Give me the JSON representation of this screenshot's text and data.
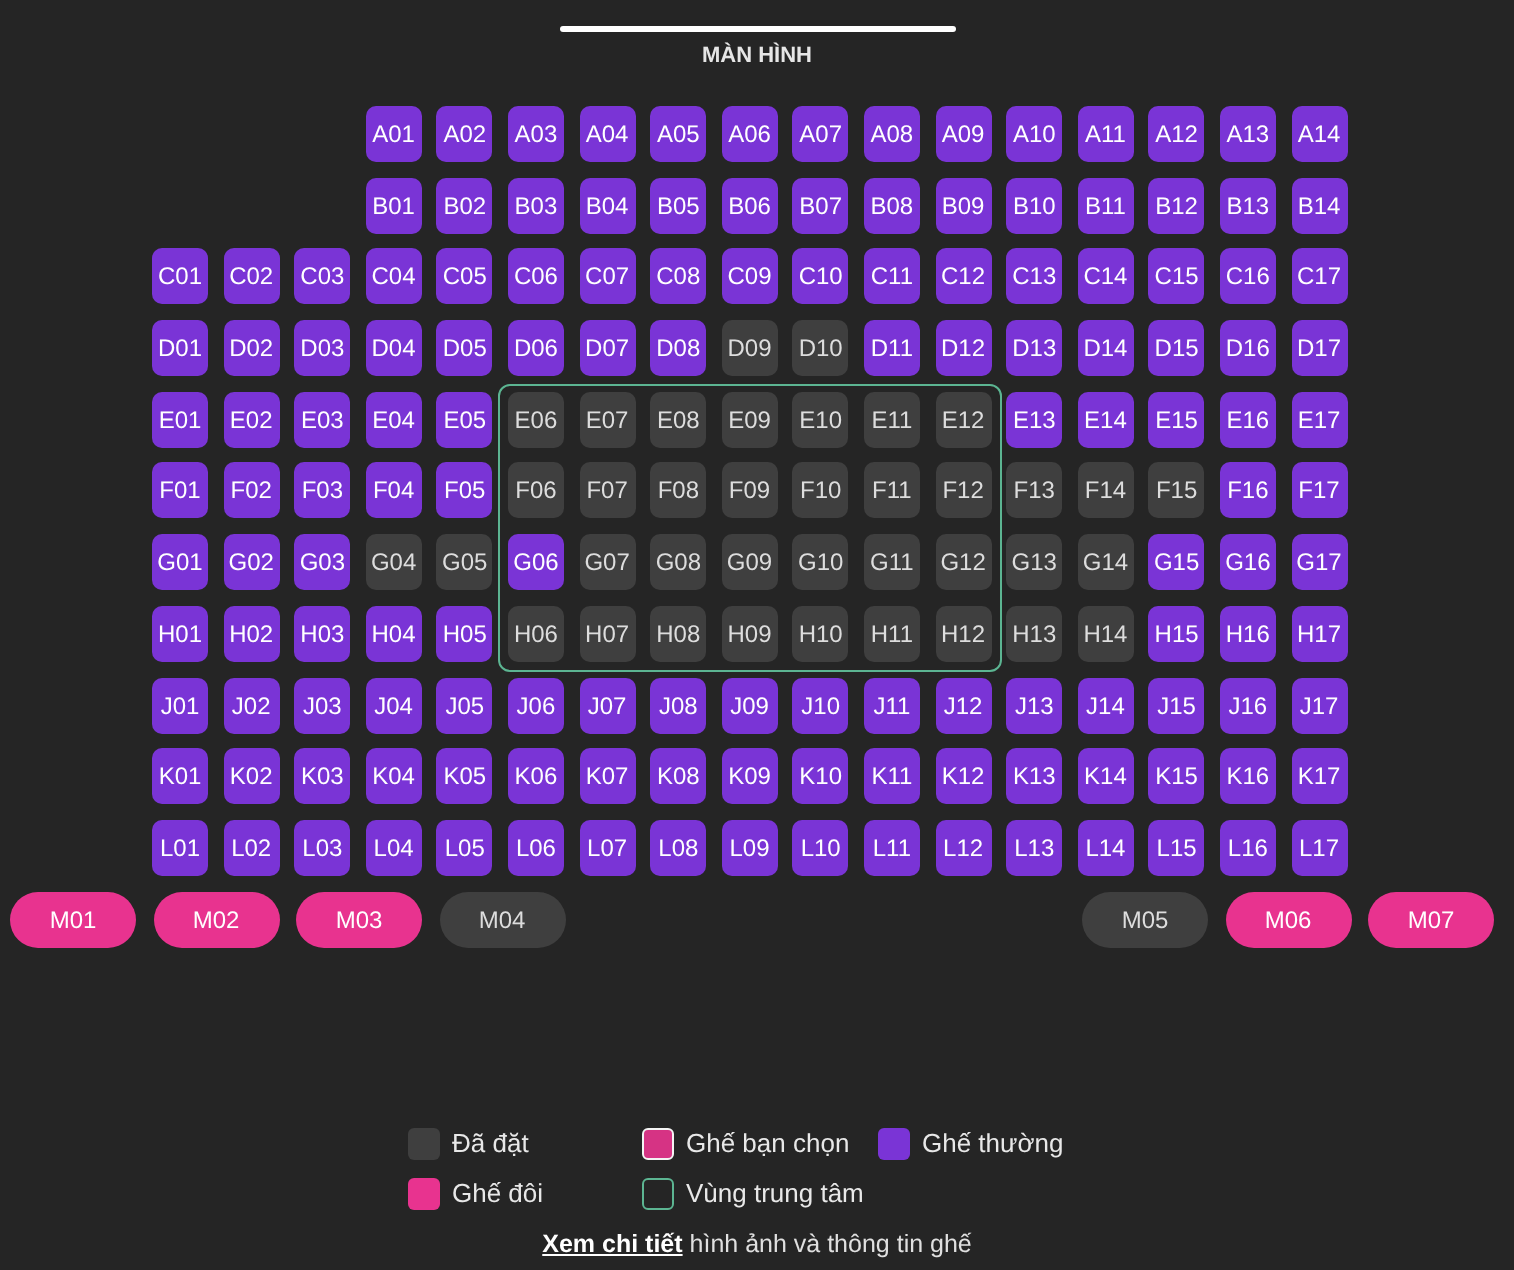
{
  "screen": {
    "label": "MÀN HÌNH"
  },
  "seat_rows": [
    {
      "seats": [
        {
          "label": "A01",
          "booked": false,
          "selected": false
        },
        {
          "label": "A02",
          "booked": false,
          "selected": false
        },
        {
          "label": "A03",
          "booked": false,
          "selected": false
        },
        {
          "label": "A04",
          "booked": false,
          "selected": false
        },
        {
          "label": "A05",
          "booked": false,
          "selected": false
        },
        {
          "label": "A06",
          "booked": false,
          "selected": false
        },
        {
          "label": "A07",
          "booked": false,
          "selected": false
        },
        {
          "label": "A08",
          "booked": false,
          "selected": false
        },
        {
          "label": "A09",
          "booked": false,
          "selected": false
        },
        {
          "label": "A10",
          "booked": false,
          "selected": false
        },
        {
          "label": "A11",
          "booked": false,
          "selected": false
        },
        {
          "label": "A12",
          "booked": false,
          "selected": false
        },
        {
          "label": "A13",
          "booked": false,
          "selected": false
        },
        {
          "label": "A14",
          "booked": false,
          "selected": false
        }
      ]
    },
    {
      "seats": [
        {
          "label": "B01",
          "booked": false,
          "selected": false
        },
        {
          "label": "B02",
          "booked": false,
          "selected": false
        },
        {
          "label": "B03",
          "booked": false,
          "selected": false
        },
        {
          "label": "B04",
          "booked": false,
          "selected": false
        },
        {
          "label": "B05",
          "booked": false,
          "selected": false
        },
        {
          "label": "B06",
          "booked": false,
          "selected": false
        },
        {
          "label": "B07",
          "booked": false,
          "selected": false
        },
        {
          "label": "B08",
          "booked": false,
          "selected": false
        },
        {
          "label": "B09",
          "booked": false,
          "selected": false
        },
        {
          "label": "B10",
          "booked": false,
          "selected": false
        },
        {
          "label": "B11",
          "booked": false,
          "selected": false
        },
        {
          "label": "B12",
          "booked": false,
          "selected": false
        },
        {
          "label": "B13",
          "booked": false,
          "selected": false
        },
        {
          "label": "B14",
          "booked": false,
          "selected": false
        }
      ]
    },
    {
      "seats": [
        {
          "label": "C01",
          "booked": false,
          "selected": false
        },
        {
          "label": "C02",
          "booked": false,
          "selected": false
        },
        {
          "label": "C03",
          "booked": false,
          "selected": false
        },
        {
          "label": "C04",
          "booked": false,
          "selected": false
        },
        {
          "label": "C05",
          "booked": false,
          "selected": false
        },
        {
          "label": "C06",
          "booked": false,
          "selected": false
        },
        {
          "label": "C07",
          "booked": false,
          "selected": false
        },
        {
          "label": "C08",
          "booked": false,
          "selected": false
        },
        {
          "label": "C09",
          "booked": false,
          "selected": false
        },
        {
          "label": "C10",
          "booked": false,
          "selected": false
        },
        {
          "label": "C11",
          "booked": false,
          "selected": false
        },
        {
          "label": "C12",
          "booked": false,
          "selected": false
        },
        {
          "label": "C13",
          "booked": false,
          "selected": false
        },
        {
          "label": "C14",
          "booked": false,
          "selected": false
        },
        {
          "label": "C15",
          "booked": false,
          "selected": false
        },
        {
          "label": "C16",
          "booked": false,
          "selected": false
        },
        {
          "label": "C17",
          "booked": false,
          "selected": false
        }
      ]
    },
    {
      "seats": [
        {
          "label": "D01",
          "booked": false,
          "selected": false
        },
        {
          "label": "D02",
          "booked": false,
          "selected": false
        },
        {
          "label": "D03",
          "booked": false,
          "selected": false
        },
        {
          "label": "D04",
          "booked": false,
          "selected": false
        },
        {
          "label": "D05",
          "booked": false,
          "selected": false
        },
        {
          "label": "D06",
          "booked": false,
          "selected": false
        },
        {
          "label": "D07",
          "booked": false,
          "selected": false
        },
        {
          "label": "D08",
          "booked": false,
          "selected": false
        },
        {
          "label": "D09",
          "booked": true,
          "selected": false
        },
        {
          "label": "D10",
          "booked": true,
          "selected": false
        },
        {
          "label": "D11",
          "booked": false,
          "selected": false
        },
        {
          "label": "D12",
          "booked": false,
          "selected": false
        },
        {
          "label": "D13",
          "booked": false,
          "selected": false
        },
        {
          "label": "D14",
          "booked": false,
          "selected": false
        },
        {
          "label": "D15",
          "booked": false,
          "selected": false
        },
        {
          "label": "D16",
          "booked": false,
          "selected": false
        },
        {
          "label": "D17",
          "booked": false,
          "selected": false
        }
      ]
    },
    {
      "seats": [
        {
          "label": "E01",
          "booked": false,
          "selected": false
        },
        {
          "label": "E02",
          "booked": false,
          "selected": false
        },
        {
          "label": "E03",
          "booked": false,
          "selected": false
        },
        {
          "label": "E04",
          "booked": false,
          "selected": false
        },
        {
          "label": "E05",
          "booked": false,
          "selected": false
        },
        {
          "label": "E06",
          "booked": true,
          "selected": false
        },
        {
          "label": "E07",
          "booked": true,
          "selected": false
        },
        {
          "label": "E08",
          "booked": true,
          "selected": false
        },
        {
          "label": "E09",
          "booked": true,
          "selected": false
        },
        {
          "label": "E10",
          "booked": true,
          "selected": false
        },
        {
          "label": "E11",
          "booked": true,
          "selected": false
        },
        {
          "label": "E12",
          "booked": true,
          "selected": false
        },
        {
          "label": "E13",
          "booked": false,
          "selected": false
        },
        {
          "label": "E14",
          "booked": false,
          "selected": false
        },
        {
          "label": "E15",
          "booked": false,
          "selected": false
        },
        {
          "label": "E16",
          "booked": false,
          "selected": false
        },
        {
          "label": "E17",
          "booked": false,
          "selected": false
        }
      ]
    },
    {
      "seats": [
        {
          "label": "F01",
          "booked": false,
          "selected": false
        },
        {
          "label": "F02",
          "booked": false,
          "selected": false
        },
        {
          "label": "F03",
          "booked": false,
          "selected": false
        },
        {
          "label": "F04",
          "booked": false,
          "selected": false
        },
        {
          "label": "F05",
          "booked": false,
          "selected": false
        },
        {
          "label": "F06",
          "booked": true,
          "selected": false
        },
        {
          "label": "F07",
          "booked": true,
          "selected": false
        },
        {
          "label": "F08",
          "booked": true,
          "selected": false
        },
        {
          "label": "F09",
          "booked": true,
          "selected": false
        },
        {
          "label": "F10",
          "booked": true,
          "selected": false
        },
        {
          "label": "F11",
          "booked": true,
          "selected": false
        },
        {
          "label": "F12",
          "booked": true,
          "selected": false
        },
        {
          "label": "F13",
          "booked": true,
          "selected": false
        },
        {
          "label": "F14",
          "booked": true,
          "selected": false
        },
        {
          "label": "F15",
          "booked": true,
          "selected": false
        },
        {
          "label": "F16",
          "booked": false,
          "selected": false
        },
        {
          "label": "F17",
          "booked": false,
          "selected": false
        }
      ]
    },
    {
      "seats": [
        {
          "label": "G01",
          "booked": false,
          "selected": false
        },
        {
          "label": "G02",
          "booked": false,
          "selected": false
        },
        {
          "label": "G03",
          "booked": false,
          "selected": false
        },
        {
          "label": "G04",
          "booked": true,
          "selected": false
        },
        {
          "label": "G05",
          "booked": true,
          "selected": false
        },
        {
          "label": "G06",
          "booked": false,
          "selected": false
        },
        {
          "label": "G07",
          "booked": true,
          "selected": false
        },
        {
          "label": "G08",
          "booked": true,
          "selected": false
        },
        {
          "label": "G09",
          "booked": true,
          "selected": false
        },
        {
          "label": "G10",
          "booked": true,
          "selected": false
        },
        {
          "label": "G11",
          "booked": true,
          "selected": false
        },
        {
          "label": "G12",
          "booked": true,
          "selected": false
        },
        {
          "label": "G13",
          "booked": true,
          "selected": false
        },
        {
          "label": "G14",
          "booked": true,
          "selected": false
        },
        {
          "label": "G15",
          "booked": false,
          "selected": false
        },
        {
          "label": "G16",
          "booked": false,
          "selected": false
        },
        {
          "label": "G17",
          "booked": false,
          "selected": false
        }
      ]
    },
    {
      "seats": [
        {
          "label": "H01",
          "booked": false,
          "selected": false
        },
        {
          "label": "H02",
          "booked": false,
          "selected": false
        },
        {
          "label": "H03",
          "booked": false,
          "selected": false
        },
        {
          "label": "H04",
          "booked": false,
          "selected": false
        },
        {
          "label": "H05",
          "booked": false,
          "selected": false
        },
        {
          "label": "H06",
          "booked": true,
          "selected": false
        },
        {
          "label": "H07",
          "booked": true,
          "selected": false
        },
        {
          "label": "H08",
          "booked": true,
          "selected": false
        },
        {
          "label": "H09",
          "booked": true,
          "selected": false
        },
        {
          "label": "H10",
          "booked": true,
          "selected": false
        },
        {
          "label": "H11",
          "booked": true,
          "selected": false
        },
        {
          "label": "H12",
          "booked": true,
          "selected": false
        },
        {
          "label": "H13",
          "booked": true,
          "selected": false
        },
        {
          "label": "H14",
          "booked": true,
          "selected": false
        },
        {
          "label": "H15",
          "booked": false,
          "selected": false
        },
        {
          "label": "H16",
          "booked": false,
          "selected": false
        },
        {
          "label": "H17",
          "booked": false,
          "selected": false
        }
      ]
    },
    {
      "seats": [
        {
          "label": "J01",
          "booked": false,
          "selected": false
        },
        {
          "label": "J02",
          "booked": false,
          "selected": false
        },
        {
          "label": "J03",
          "booked": false,
          "selected": false
        },
        {
          "label": "J04",
          "booked": false,
          "selected": false
        },
        {
          "label": "J05",
          "booked": false,
          "selected": false
        },
        {
          "label": "J06",
          "booked": false,
          "selected": false
        },
        {
          "label": "J07",
          "booked": false,
          "selected": false
        },
        {
          "label": "J08",
          "booked": false,
          "selected": false
        },
        {
          "label": "J09",
          "booked": false,
          "selected": false
        },
        {
          "label": "J10",
          "booked": false,
          "selected": false
        },
        {
          "label": "J11",
          "booked": false,
          "selected": false
        },
        {
          "label": "J12",
          "booked": false,
          "selected": false
        },
        {
          "label": "J13",
          "booked": false,
          "selected": false
        },
        {
          "label": "J14",
          "booked": false,
          "selected": false
        },
        {
          "label": "J15",
          "booked": false,
          "selected": false
        },
        {
          "label": "J16",
          "booked": false,
          "selected": false
        },
        {
          "label": "J17",
          "booked": false,
          "selected": false
        }
      ]
    },
    {
      "seats": [
        {
          "label": "K01",
          "booked": false,
          "selected": false
        },
        {
          "label": "K02",
          "booked": false,
          "selected": false
        },
        {
          "label": "K03",
          "booked": false,
          "selected": false
        },
        {
          "label": "K04",
          "booked": false,
          "selected": false
        },
        {
          "label": "K05",
          "booked": false,
          "selected": false
        },
        {
          "label": "K06",
          "booked": false,
          "selected": false
        },
        {
          "label": "K07",
          "booked": false,
          "selected": false
        },
        {
          "label": "K08",
          "booked": false,
          "selected": false
        },
        {
          "label": "K09",
          "booked": false,
          "selected": false
        },
        {
          "label": "K10",
          "booked": false,
          "selected": false
        },
        {
          "label": "K11",
          "booked": false,
          "selected": false
        },
        {
          "label": "K12",
          "booked": false,
          "selected": false
        },
        {
          "label": "K13",
          "booked": false,
          "selected": false
        },
        {
          "label": "K14",
          "booked": false,
          "selected": false
        },
        {
          "label": "K15",
          "booked": false,
          "selected": false
        },
        {
          "label": "K16",
          "booked": false,
          "selected": false
        },
        {
          "label": "K17",
          "booked": false,
          "selected": false
        }
      ]
    },
    {
      "seats": [
        {
          "label": "L01",
          "booked": false,
          "selected": false
        },
        {
          "label": "L02",
          "booked": false,
          "selected": false
        },
        {
          "label": "L03",
          "booked": false,
          "selected": false
        },
        {
          "label": "L04",
          "booked": false,
          "selected": false
        },
        {
          "label": "L05",
          "booked": false,
          "selected": false
        },
        {
          "label": "L06",
          "booked": false,
          "selected": false
        },
        {
          "label": "L07",
          "booked": false,
          "selected": false
        },
        {
          "label": "L08",
          "booked": false,
          "selected": false
        },
        {
          "label": "L09",
          "booked": false,
          "selected": false
        },
        {
          "label": "L10",
          "booked": false,
          "selected": false
        },
        {
          "label": "L11",
          "booked": false,
          "selected": false
        },
        {
          "label": "L12",
          "booked": false,
          "selected": false
        },
        {
          "label": "L13",
          "booked": false,
          "selected": false
        },
        {
          "label": "L14",
          "booked": false,
          "selected": false
        },
        {
          "label": "L15",
          "booked": false,
          "selected": false
        },
        {
          "label": "L16",
          "booked": false,
          "selected": false
        },
        {
          "label": "L17",
          "booked": false,
          "selected": false
        }
      ]
    }
  ],
  "couple_row": {
    "left": [
      {
        "label": "M01",
        "booked": false,
        "selected": false
      },
      {
        "label": "M02",
        "booked": false,
        "selected": false
      },
      {
        "label": "M03",
        "booked": false,
        "selected": false
      },
      {
        "label": "M04",
        "booked": true,
        "selected": false
      }
    ],
    "right": [
      {
        "label": "M05",
        "booked": true,
        "selected": false
      },
      {
        "label": "M06",
        "booked": false,
        "selected": false
      },
      {
        "label": "M07",
        "booked": false,
        "selected": false
      }
    ]
  },
  "legend": [
    {
      "kind": "booked",
      "label": "Đã đặt"
    },
    {
      "kind": "selected",
      "label": "Ghế bạn chọn"
    },
    {
      "kind": "regular",
      "label": "Ghế thường"
    },
    {
      "kind": "couple",
      "label": "Ghế đôi"
    },
    {
      "kind": "zone",
      "label": "Vùng trung tâm"
    }
  ],
  "details": {
    "link": "Xem chi tiết",
    "text": "hình ảnh và thông tin ghế"
  }
}
